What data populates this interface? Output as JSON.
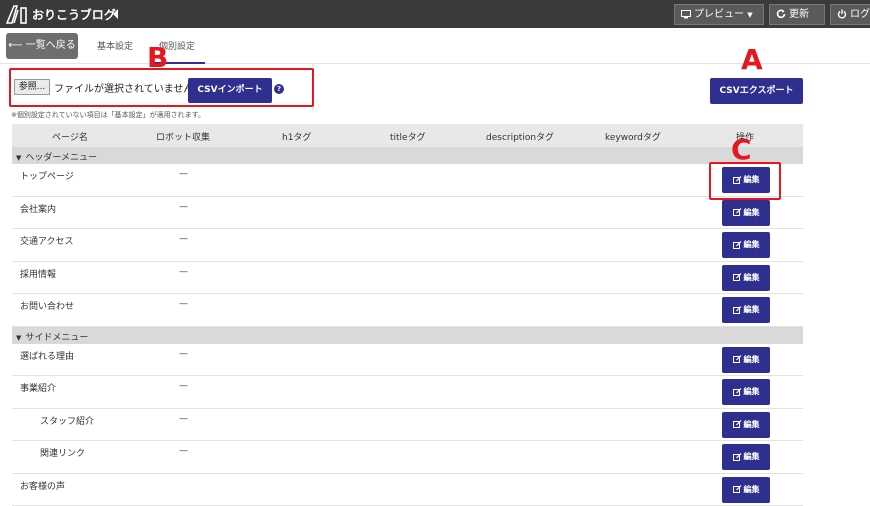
{
  "topbar": {
    "site_title": "おりこうブログ",
    "preview_label": "プレビュー",
    "update_label": "更新",
    "logout_label": "ログ"
  },
  "subheader": {
    "back_label": "一覧へ戻る",
    "tabs": [
      "基本設定",
      "個別設定"
    ]
  },
  "import": {
    "file_button": "参照...",
    "file_status": "ファイルが選択されていません。",
    "import_label": "CSVインポート",
    "help": "?",
    "export_label": "CSVエクスポート",
    "note": "※個別設定されていない項目は「基本設定」が適用されます。"
  },
  "annotations": {
    "a": "A",
    "b": "B",
    "c": "C",
    "color": "#e8161f"
  },
  "table": {
    "headers": [
      "ページ名",
      "ロボット収集",
      "h1タグ",
      "titleタグ",
      "descriptionタグ",
      "keywordタグ",
      "操作"
    ],
    "edit_label": "編集",
    "groups": [
      {
        "label": "ヘッダーメニュー",
        "rows": [
          {
            "name": "トップページ",
            "robot": "—"
          },
          {
            "name": "会社案内",
            "robot": "—"
          },
          {
            "name": "交通アクセス",
            "robot": "—"
          },
          {
            "name": "採用情報",
            "robot": "—"
          },
          {
            "name": "お問い合わせ",
            "robot": "—"
          }
        ]
      },
      {
        "label": "サイドメニュー",
        "rows": [
          {
            "name": "選ばれる理由",
            "robot": "—"
          },
          {
            "name": "事業紹介",
            "robot": "—"
          },
          {
            "name": "スタッフ紹介",
            "robot": "—"
          },
          {
            "name": "関連リンク",
            "robot": "—"
          },
          {
            "name": "お客様の声",
            "robot": ""
          }
        ]
      }
    ]
  },
  "colors": {
    "navy": "#2e2f8f",
    "topbar": "#3a3a3a",
    "red": "#e8161f"
  }
}
